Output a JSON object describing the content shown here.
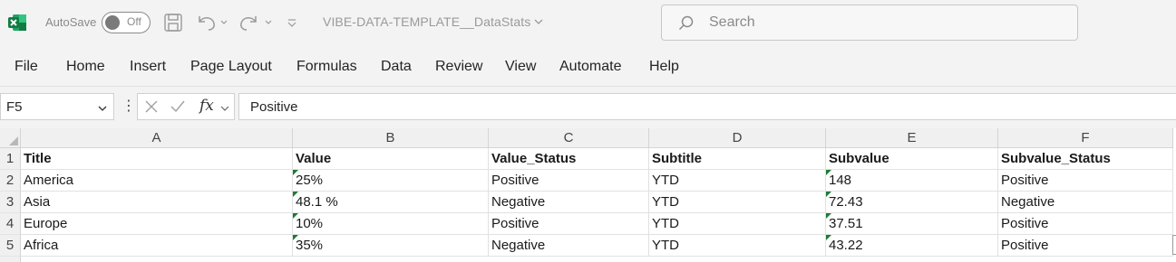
{
  "titlebar": {
    "autosave_label": "AutoSave",
    "autosave_state": "Off",
    "doc_title": "VIBE-DATA-TEMPLATE__DataStats",
    "search_placeholder": "Search"
  },
  "menu": [
    "File",
    "Home",
    "Insert",
    "Page Layout",
    "Formulas",
    "Data",
    "Review",
    "View",
    "Automate",
    "Help"
  ],
  "formula_bar": {
    "name_box": "F5",
    "fx_label": "fx",
    "content": "Positive"
  },
  "sheet": {
    "columns": [
      "A",
      "B",
      "C",
      "D",
      "E",
      "F"
    ],
    "rows": [
      "1",
      "2",
      "3",
      "4",
      "5"
    ],
    "cells": [
      [
        "Title",
        "Value",
        "Value_Status",
        "Subtitle",
        "Subvalue",
        "Subvalue_Status"
      ],
      [
        "America",
        "25%",
        "Positive",
        "YTD",
        "148",
        "Positive"
      ],
      [
        "Asia",
        "48.1 %",
        "Negative",
        "YTD",
        "72.43",
        "Negative"
      ],
      [
        "Europe",
        "10%",
        "Positive",
        "YTD",
        "37.51",
        "Positive"
      ],
      [
        "Africa",
        "35%",
        "Negative",
        "YTD",
        "43.22",
        "Positive"
      ]
    ],
    "selected_cell": "F5"
  },
  "colors": {
    "excel_green": "#107c41",
    "error_flag": "#1e7b34",
    "chrome_bg": "#f3f3f3"
  },
  "icons": [
    "excel-logo-icon",
    "save-icon",
    "undo-icon",
    "redo-icon",
    "customize-toolbar-icon",
    "search-icon",
    "cancel-icon",
    "enter-icon",
    "chevron-down-icon"
  ]
}
